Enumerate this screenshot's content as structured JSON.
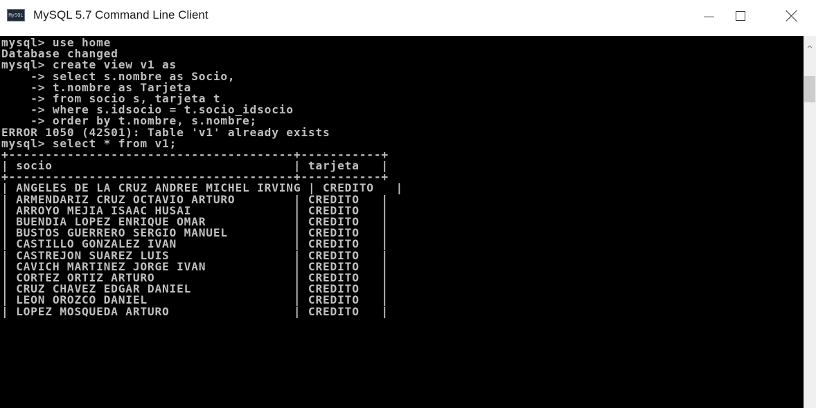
{
  "window": {
    "title": "MySQL 5.7 Command Line Client",
    "icon_label": "MySQL",
    "controls": {
      "minimize": "minimize-icon",
      "maximize": "maximize-icon",
      "close": "close-icon"
    }
  },
  "console": {
    "lines": [
      "mysql> use home",
      "Database changed",
      "mysql> create view v1 as",
      "    -> select s.nombre as Socio,",
      "    -> t.nombre as Tarjeta",
      "    -> from socio s, tarjeta t",
      "    -> where s.idsocio = t.socio_idsocio",
      "    -> order by t.nombre, s.nombre;",
      "ERROR 1050 (42S01): Table 'v1' already exists",
      "mysql> select * from v1;",
      "+---------------------------------------+-----------+",
      "| socio                                 | tarjeta   |",
      "+---------------------------------------+-----------+",
      "| ANGELES DE LA CRUZ ANDREE MICHEL IRVING | CREDITO   |",
      "| ARMENDARIZ CRUZ OCTAVIO ARTURO        | CREDITO   |",
      "| ARROYO MEJIA ISAAC HUSAI              | CREDITO   |",
      "| BUENDIA LOPEZ ENRIQUE OMAR            | CREDITO   |",
      "| BUSTOS GUERRERO SERGIO MANUEL         | CREDITO   |",
      "| CASTILLO GONZALEZ IVAN                | CREDITO   |",
      "| CASTREJON SUAREZ LUIS                 | CREDITO   |",
      "| CAVICH MARTINEZ JORGE IVAN            | CREDITO   |",
      "| CORTEZ ORTIZ ARTURO                   | CREDITO   |",
      "| CRUZ CHAVEZ EDGAR DANIEL              | CREDITO   |",
      "| LEON OROZCO DANIEL                    | CREDITO   |",
      "| LOPEZ MOSQUEDA ARTURO                 | CREDITO   |"
    ]
  },
  "scrollbar": {
    "up_icon": "scroll-up-icon",
    "down_icon": "scroll-down-icon"
  },
  "colors": {
    "console_bg": "#000000",
    "console_fg": "#c0c0c0",
    "titlebar_bg": "#ffffff",
    "scrollbar_bg": "#f0f0f0",
    "scrollbar_thumb": "#cdcdcd"
  }
}
